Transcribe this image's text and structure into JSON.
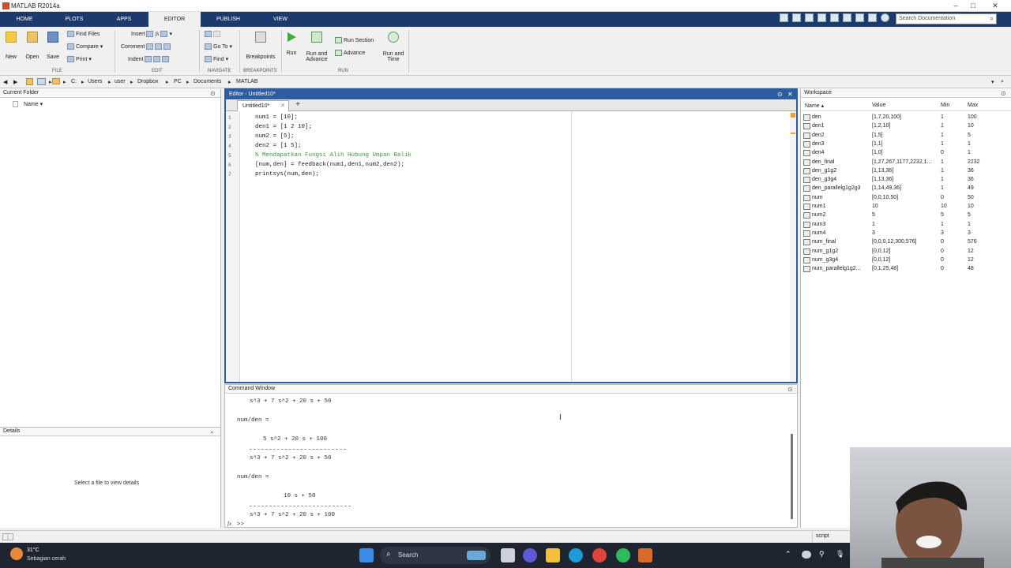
{
  "window": {
    "title": "MATLAB R2014a"
  },
  "ribbon": {
    "tabs": [
      "HOME",
      "PLOTS",
      "APPS",
      "EDITOR",
      "PUBLISH",
      "VIEW"
    ],
    "active_tab": "EDITOR",
    "search_placeholder": "Search Documentation",
    "file": {
      "new": "New",
      "open": "Open",
      "save": "Save",
      "find_files": "Find Files",
      "compare": "Compare",
      "print": "Print",
      "section": "FILE"
    },
    "edit": {
      "insert": "Insert",
      "comment": "Comment",
      "indent": "Indent",
      "section": "EDIT"
    },
    "navigate": {
      "goto": "Go To",
      "find": "Find",
      "section": "NAVIGATE"
    },
    "breakpoints": {
      "label": "Breakpoints",
      "section": "BREAKPOINTS"
    },
    "run": {
      "run": "Run",
      "run_advance_1": "Run and",
      "run_advance_2": "Advance",
      "run_section": "Run Section",
      "advance": "Advance",
      "run_time_1": "Run and",
      "run_time_2": "Time",
      "section": "RUN"
    }
  },
  "address": {
    "path": [
      "C:",
      "Users",
      "user",
      "Dropbox",
      "PC",
      "Documents",
      "MATLAB"
    ]
  },
  "current_folder": {
    "title": "Current Folder",
    "col_name": "Name"
  },
  "details": {
    "title": "Details",
    "message": "Select a file to view details"
  },
  "editor": {
    "title": "Editor - Untitled10*",
    "tab": "Untitled10*",
    "lines": [
      {
        "n": "1",
        "text": "num1 = [10];",
        "comment": false
      },
      {
        "n": "2",
        "text": "den1 = [1 2 10];",
        "comment": false
      },
      {
        "n": "3",
        "text": "num2 = [5];",
        "comment": false
      },
      {
        "n": "4",
        "text": "den2 = [1 5];",
        "comment": false
      },
      {
        "n": "5",
        "text": "% Mendapatkan Fungsi Alih Hubung Umpan Balik",
        "comment": true
      },
      {
        "n": "6",
        "text": "[num,den] = feedback(num1,den1,num2,den2);",
        "comment": false
      },
      {
        "n": "7",
        "text": "printsys(num,den);",
        "comment": false
      }
    ]
  },
  "command_window": {
    "title": "Command Window",
    "lines": [
      "s^3 + 7 s^2 + 20 s + 50",
      "num/den =",
      "5 s^2 + 20 s + 100",
      "s^3 + 7 s^2 + 20 s + 50",
      "num/den =",
      "10 s + 50",
      "s^3 + 7 s^2 + 20 s + 100"
    ],
    "prompt": ">>",
    "fx": "fx"
  },
  "workspace": {
    "title": "Workspace",
    "headers": {
      "name": "Name",
      "value": "Value",
      "min": "Min",
      "max": "Max"
    },
    "rows": [
      {
        "name": "den",
        "value": "[1,7,20,100]",
        "min": "1",
        "max": "100"
      },
      {
        "name": "den1",
        "value": "[1,2,10]",
        "min": "1",
        "max": "10"
      },
      {
        "name": "den2",
        "value": "[1,5]",
        "min": "1",
        "max": "5"
      },
      {
        "name": "den3",
        "value": "[1,1]",
        "min": "1",
        "max": "1"
      },
      {
        "name": "den4",
        "value": "[1,0]",
        "min": "0",
        "max": "1"
      },
      {
        "name": "den_final",
        "value": "[1,27,267,1177,2232,1...",
        "min": "1",
        "max": "2232"
      },
      {
        "name": "den_g1g2",
        "value": "[1,13,36]",
        "min": "1",
        "max": "36"
      },
      {
        "name": "den_g3g4",
        "value": "[1,13,36]",
        "min": "1",
        "max": "36"
      },
      {
        "name": "den_parallelg1g2g3",
        "value": "[1,14,49,36]",
        "min": "1",
        "max": "49"
      },
      {
        "name": "num",
        "value": "[0,0,10,50]",
        "min": "0",
        "max": "50"
      },
      {
        "name": "num1",
        "value": "10",
        "min": "10",
        "max": "10"
      },
      {
        "name": "num2",
        "value": "5",
        "min": "5",
        "max": "5"
      },
      {
        "name": "num3",
        "value": "1",
        "min": "1",
        "max": "1"
      },
      {
        "name": "num4",
        "value": "3",
        "min": "3",
        "max": "3"
      },
      {
        "name": "num_final",
        "value": "[0,0,0,12,300,576]",
        "min": "0",
        "max": "576"
      },
      {
        "name": "num_g1g2",
        "value": "[0,0,12]",
        "min": "0",
        "max": "12"
      },
      {
        "name": "num_g3g4",
        "value": "[0,0,12]",
        "min": "0",
        "max": "12"
      },
      {
        "name": "num_parallelg1g2...",
        "value": "[0,1,25,48]",
        "min": "0",
        "max": "48"
      }
    ]
  },
  "statusbar": {
    "mode": "script"
  },
  "taskbar": {
    "weather_temp": "31°C",
    "weather_desc": "Sebagian cerah",
    "search": "Search"
  },
  "colors": {
    "ribbon_bg": "#1c3a6b",
    "editor_accent": "#2d5d9c",
    "comment": "#3a9a3a",
    "taskbar": "#1e2530"
  }
}
